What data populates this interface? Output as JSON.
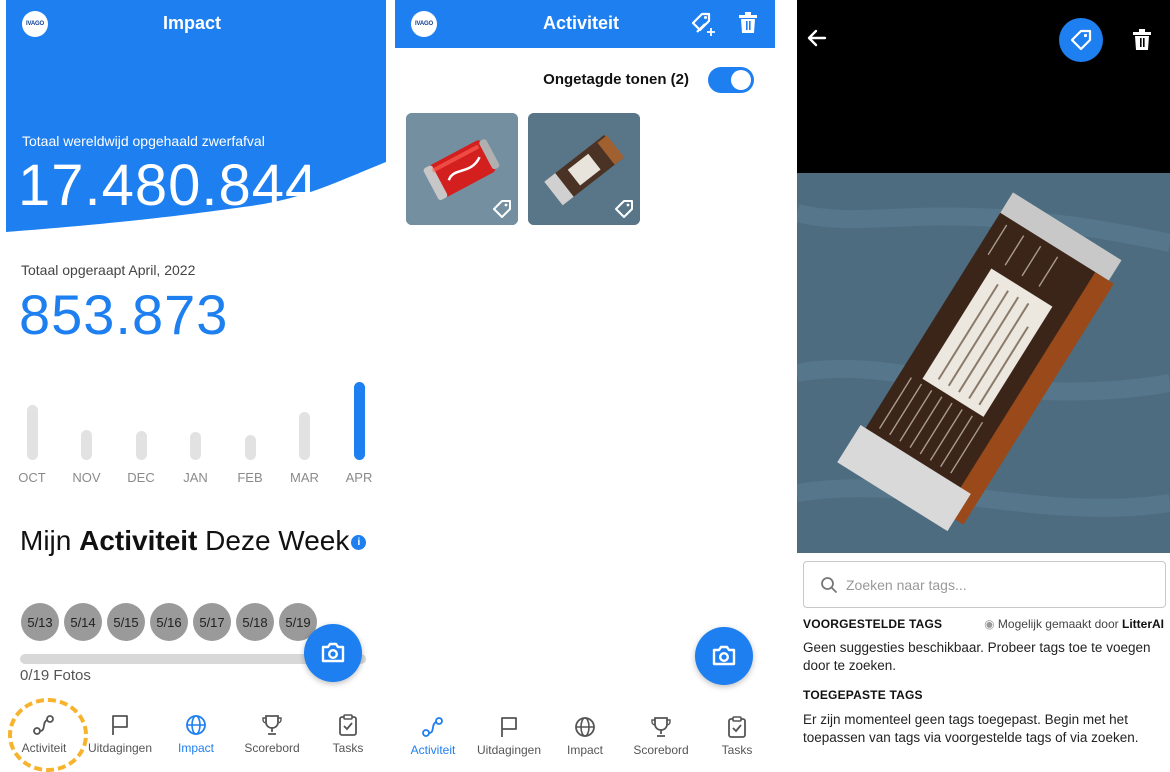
{
  "colors": {
    "accent": "#1e7ff0",
    "highlight": "#f7b32b"
  },
  "panel1": {
    "header_title": "Impact",
    "logo_text": "IVAGO",
    "total_label": "Totaal wereldwijd opgehaald zwerfafval",
    "total_value": "17.480.844",
    "month_label": "Totaal opgeraapt April, 2022",
    "month_value": "853.873",
    "chart_data": {
      "type": "bar",
      "categories": [
        "OCT",
        "NOV",
        "DEC",
        "JAN",
        "FEB",
        "MAR",
        "APR"
      ],
      "values": [
        0.7,
        0.38,
        0.37,
        0.36,
        0.32,
        0.62,
        1.0
      ],
      "highlighted": "APR"
    },
    "week_title_pre": "Mijn",
    "week_title_bold": "Activiteit",
    "week_title_post": "Deze Week",
    "info_icon": "i",
    "days": [
      "5/13",
      "5/14",
      "5/15",
      "5/16",
      "5/17",
      "5/18",
      "5/19"
    ],
    "photos_text": "0/19 Fotos",
    "photos_progress": 0
  },
  "panel2": {
    "header_title": "Activiteit",
    "logo_text": "IVAGO",
    "toggle_label": "Ongetagde tonen (2)",
    "toggle_on": true,
    "thumbnails": [
      {
        "name": "can-photo",
        "icon": "tag-icon"
      },
      {
        "name": "wrapper-photo",
        "icon": "tag-icon"
      }
    ]
  },
  "tabs": [
    "Activiteit",
    "Uitdagingen",
    "Impact",
    "Scorebord",
    "Tasks"
  ],
  "panel3": {
    "search_placeholder": "Zoeken naar tags...",
    "suggested_title": "VOORGESTELDE TAGS",
    "powered_prefix": "Mogelijk gemaakt door",
    "powered_brand": "LitterAI",
    "suggested_text": "Geen suggesties beschikbaar. Probeer tags toe te voegen door te zoeken.",
    "applied_title": "TOEGEPASTE TAGS",
    "applied_text": "Er zijn momenteel geen tags toegepast. Begin met het toepassen van tags via voorgestelde tags of via zoeken."
  }
}
